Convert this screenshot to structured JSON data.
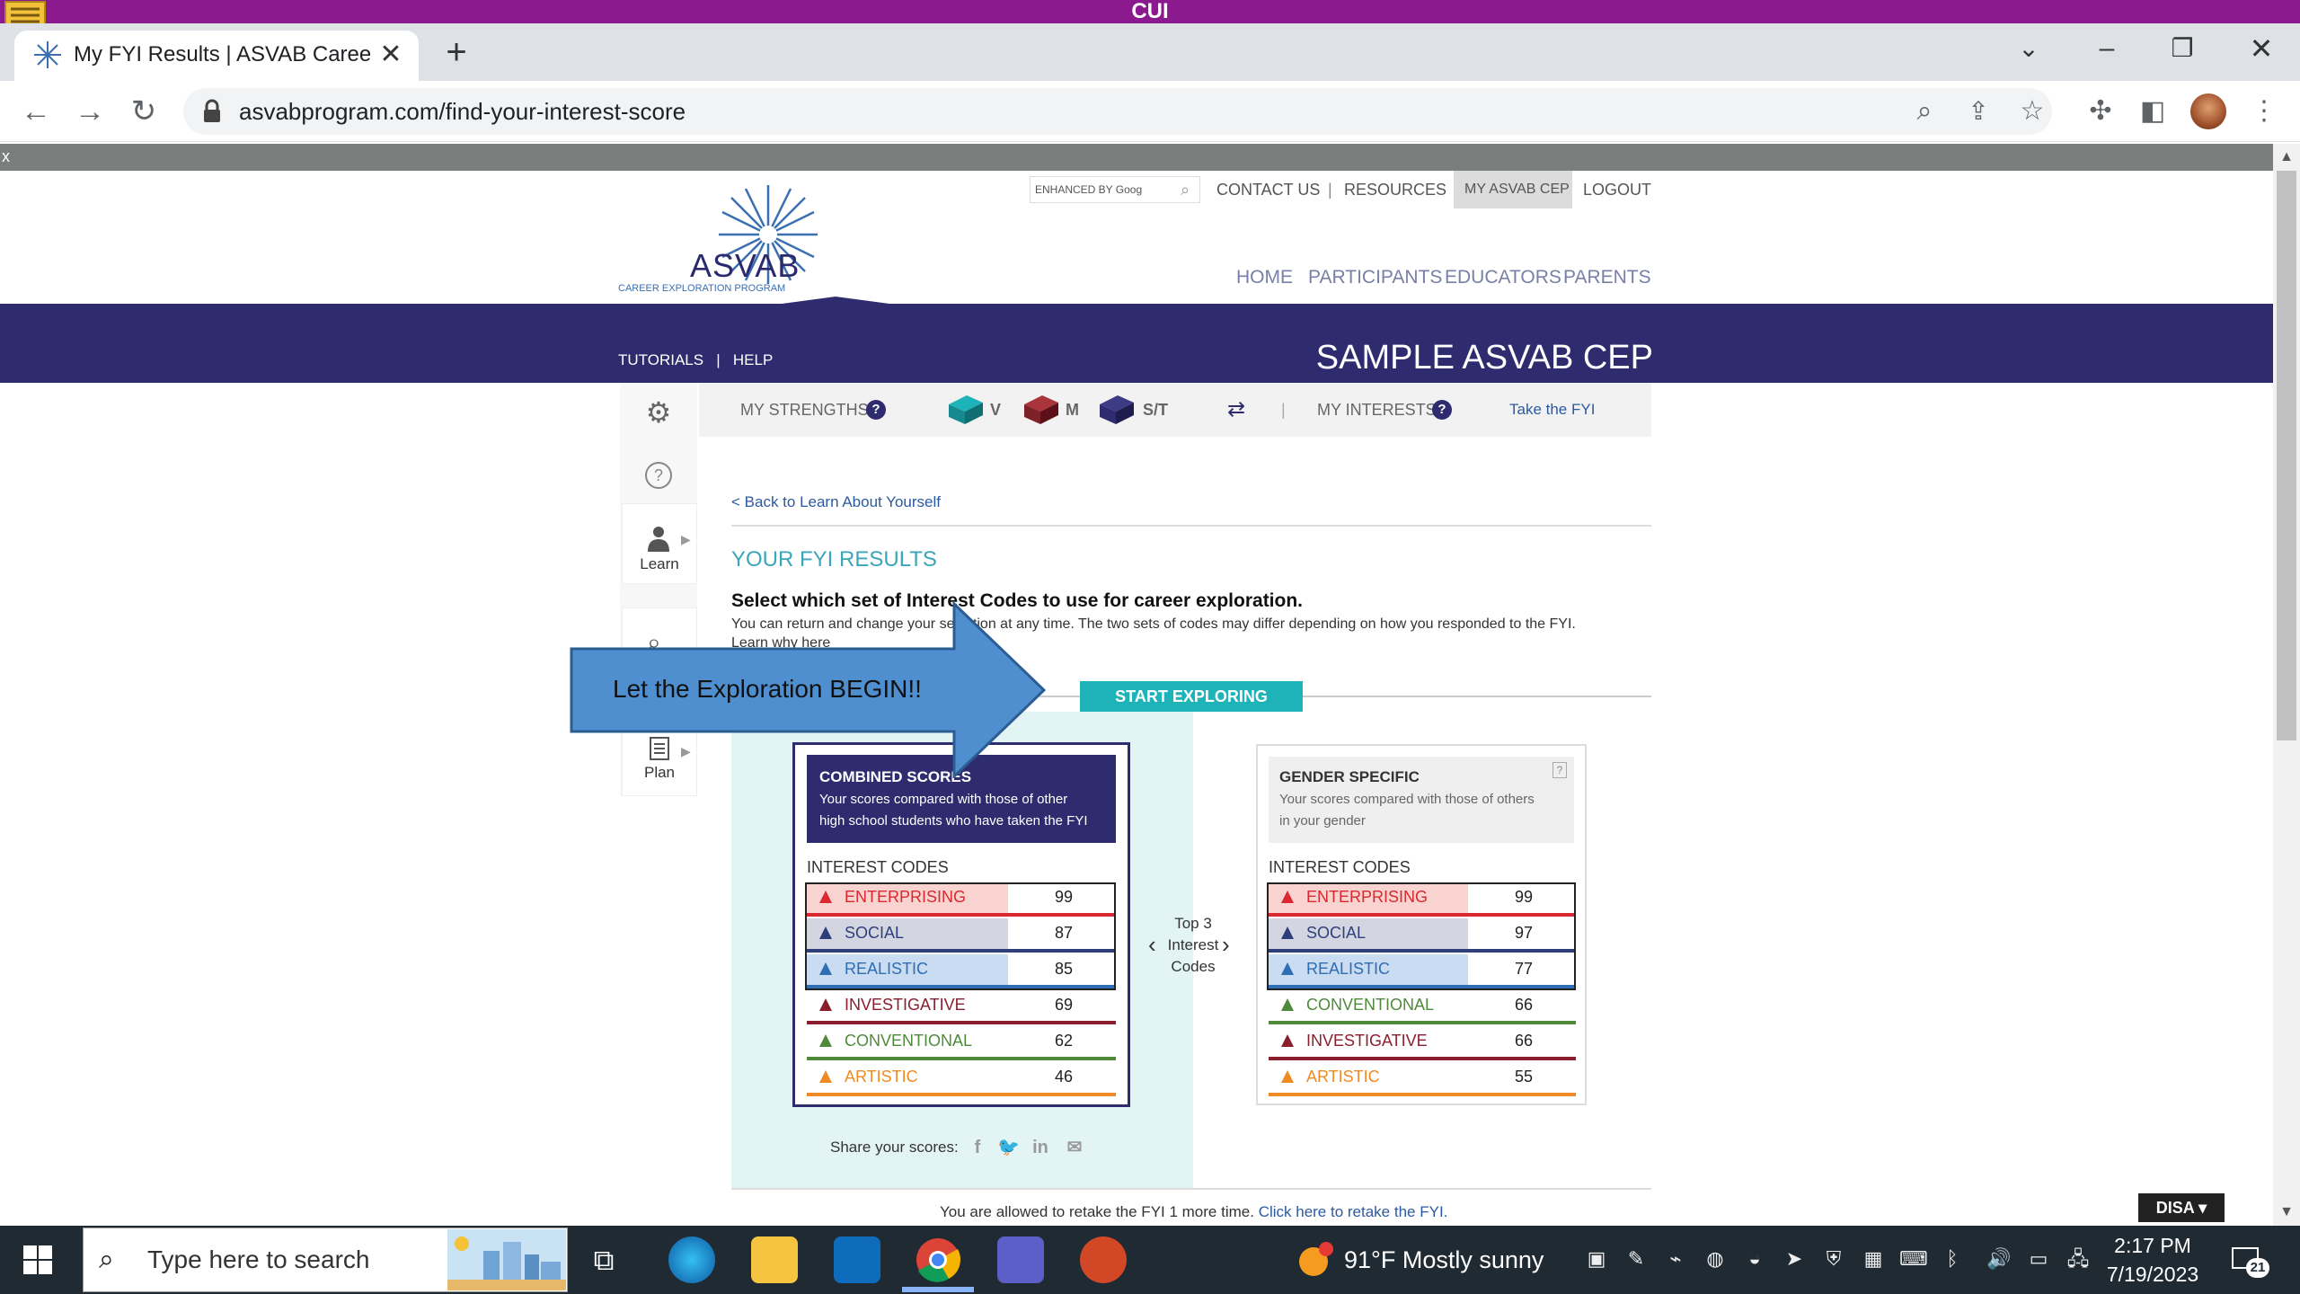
{
  "banner": {
    "text": "CUI"
  },
  "browser": {
    "tab_title": "My FYI Results | ASVAB Career Ex",
    "tab_close": "✕",
    "new_tab": "+",
    "url": "asvabprogram.com/find-your-interest-score"
  },
  "site": {
    "search_placeholder": "ENHANCED BY Goog",
    "top_links": [
      "CONTACT US",
      "RESOURCES",
      "MY ASVAB CEP",
      "LOGOUT"
    ],
    "logo_text": "ASVAB",
    "logo_sub": "CAREER EXPLORATION PROGRAM",
    "main_nav": [
      "HOME",
      "PARTICIPANTS",
      "EDUCATORS",
      "PARENTS"
    ],
    "sub_links": [
      "TUTORIALS",
      "HELP"
    ],
    "band_title": "SAMPLE ASVAB CEP"
  },
  "strengths": {
    "label": "MY STRENGTHS",
    "items": [
      "V",
      "M",
      "S/T"
    ],
    "interests_label": "MY INTERESTS",
    "take_fyi": "Take the FYI"
  },
  "sidebar": {
    "learn": "Learn",
    "plan": "Plan"
  },
  "content": {
    "back_link": "< Back to Learn About Yourself",
    "title": "YOUR FYI RESULTS",
    "select_title": "Select which set of Interest Codes to use for career exploration.",
    "select_sub": "You can return and change your selection at any time. The two sets of codes may differ depending on how you responded to the FYI.",
    "learn_why": "Learn why here",
    "start_button": "START EXPLORING",
    "top3": [
      "Top 3",
      "Interest",
      "Codes"
    ],
    "share_label": "Share your scores:",
    "retake_text": "You are allowed to retake the FYI 1 more time.",
    "retake_link": "Click here to retake the FYI."
  },
  "combined": {
    "title": "COMBINED SCORES",
    "desc_1": "Your scores compared with those of other",
    "desc_2": "high school students who have taken the FYI",
    "codes_label": "INTEREST CODES",
    "rows": [
      {
        "name": "ENTERPRISING",
        "value": "99",
        "color": "#d9282f",
        "fill": "#f9d3cf"
      },
      {
        "name": "SOCIAL",
        "value": "87",
        "color": "#2e3f7c",
        "fill": "#d3d6e0"
      },
      {
        "name": "REALISTIC",
        "value": "85",
        "color": "#2f6db5",
        "fill": "#c9dcf2"
      },
      {
        "name": "INVESTIGATIVE",
        "value": "69",
        "color": "#8b1e2d",
        "fill": ""
      },
      {
        "name": "CONVENTIONAL",
        "value": "62",
        "color": "#4e8a3a",
        "fill": ""
      },
      {
        "name": "ARTISTIC",
        "value": "46",
        "color": "#f08a24",
        "fill": ""
      }
    ]
  },
  "gender": {
    "title": "GENDER SPECIFIC",
    "desc_1": "Your scores compared with those of others",
    "desc_2": "in your gender",
    "codes_label": "INTEREST CODES",
    "help": "?",
    "rows": [
      {
        "name": "ENTERPRISING",
        "value": "99",
        "color": "#d9282f",
        "fill": "#f9d3cf"
      },
      {
        "name": "SOCIAL",
        "value": "97",
        "color": "#2e3f7c",
        "fill": "#d3d6e0"
      },
      {
        "name": "REALISTIC",
        "value": "77",
        "color": "#2f6db5",
        "fill": "#c9dcf2"
      },
      {
        "name": "CONVENTIONAL",
        "value": "66",
        "color": "#4e8a3a",
        "fill": ""
      },
      {
        "name": "INVESTIGATIVE",
        "value": "66",
        "color": "#8b1e2d",
        "fill": ""
      },
      {
        "name": "ARTISTIC",
        "value": "55",
        "color": "#f08a24",
        "fill": ""
      }
    ]
  },
  "callout": {
    "text": "Let the Exploration BEGIN!!"
  },
  "taskbar": {
    "search_text": "Type here to search",
    "weather": "91°F  Mostly sunny",
    "time": "2:17 PM",
    "date": "7/19/2023",
    "notif_count": "21",
    "disa": "DISA"
  }
}
